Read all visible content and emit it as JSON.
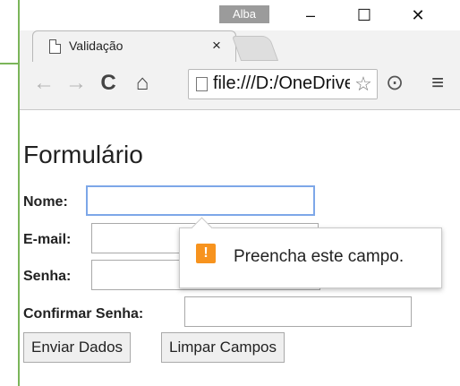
{
  "browser": {
    "profile_name": "Alba",
    "window_controls": {
      "minimize": "–",
      "maximize": "☐",
      "close": "✕"
    },
    "tab": {
      "title": "Validação",
      "close": "×"
    },
    "toolbar": {
      "back": "←",
      "forward": "→",
      "reload": "C",
      "home": "⌂",
      "address": "file:///D:/OneDrive",
      "bookmark_star": "☆",
      "camera": "⊙",
      "menu": "≡"
    }
  },
  "form": {
    "title": "Formulário",
    "nome_label": "Nome:",
    "email_label": "E-mail:",
    "senha_label": "Senha:",
    "confirmar_label": "Confirmar Senha:",
    "nome_value": "",
    "email_value": "",
    "senha_value": "",
    "confirmar_value": "",
    "submit_label": "Enviar Dados",
    "reset_label": "Limpar Campos"
  },
  "validation_tooltip": {
    "icon": "!",
    "message": "Preencha este campo."
  },
  "colors": {
    "accent_line": "#7bb55a",
    "focus_border": "#7da7e8",
    "warning_icon": "#f7931e",
    "profile_badge": "#9b9b9b"
  }
}
